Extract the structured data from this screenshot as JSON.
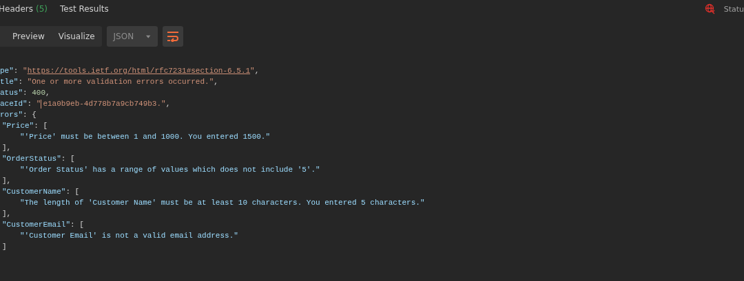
{
  "tabs": [
    {
      "label": "Headers",
      "count": "(5)",
      "selected": false
    },
    {
      "label": "Test Results",
      "selected": false
    }
  ],
  "status": {
    "label": "Statu"
  },
  "view_modes": [
    {
      "label": "Preview",
      "selected": false
    },
    {
      "label": "Visualize",
      "selected": false
    }
  ],
  "format_dropdown": {
    "value": "JSON"
  },
  "wrap_button": {
    "on": true
  },
  "code": [
    {
      "tokens": [
        {
          "kind": "key",
          "text": "pe\""
        },
        {
          "kind": "punct",
          "text": ": "
        },
        {
          "kind": "string",
          "text": "\""
        },
        {
          "kind": "link",
          "text": "https://tools.ietf.org/html/rfc7231#section-6.5.1"
        },
        {
          "kind": "string",
          "text": "\""
        },
        {
          "kind": "punct",
          "text": ","
        }
      ]
    },
    {
      "tokens": [
        {
          "kind": "key",
          "text": "tle\""
        },
        {
          "kind": "punct",
          "text": ": "
        },
        {
          "kind": "string",
          "text": "\"One or more validation errors occurred.\""
        },
        {
          "kind": "punct",
          "text": ","
        }
      ]
    },
    {
      "tokens": [
        {
          "kind": "key",
          "text": "atus\""
        },
        {
          "kind": "punct",
          "text": ": "
        },
        {
          "kind": "number",
          "text": "400"
        },
        {
          "kind": "punct",
          "text": ","
        }
      ]
    },
    {
      "tokens": [
        {
          "kind": "key",
          "text": "aceId\""
        },
        {
          "kind": "punct",
          "text": ": "
        },
        {
          "kind": "string",
          "text": "\""
        },
        {
          "kind": "cursor"
        },
        {
          "kind": "string",
          "text": "e1a0b9eb-4d778b7a9cb749b3.\""
        },
        {
          "kind": "punct",
          "text": ","
        }
      ]
    },
    {
      "tokens": [
        {
          "kind": "key",
          "text": "rors\""
        },
        {
          "kind": "punct",
          "text": ": {"
        }
      ],
      "children": [
        {
          "tokens": [
            {
              "kind": "key",
              "text": "\"Price\""
            },
            {
              "kind": "punct",
              "text": ": ["
            }
          ],
          "children": [
            {
              "tokens": [
                {
                  "kind": "value",
                  "text": "\"'Price' must be between 1 and 1000. You entered 1500.\""
                }
              ]
            }
          ]
        },
        {
          "tokens": [
            {
              "kind": "punct",
              "text": "],"
            }
          ]
        },
        {
          "tokens": [
            {
              "kind": "key",
              "text": "\"OrderStatus\""
            },
            {
              "kind": "punct",
              "text": ": ["
            }
          ],
          "children": [
            {
              "tokens": [
                {
                  "kind": "value",
                  "text": "\"'Order Status' has a range of values which does not include '5'.\""
                }
              ]
            }
          ]
        },
        {
          "tokens": [
            {
              "kind": "punct",
              "text": "],"
            }
          ]
        },
        {
          "tokens": [
            {
              "kind": "key",
              "text": "\"CustomerName\""
            },
            {
              "kind": "punct",
              "text": ": ["
            }
          ],
          "children": [
            {
              "tokens": [
                {
                  "kind": "value",
                  "text": "\"The length of 'Customer Name' must be at least 10 characters. You entered 5 characters.\""
                }
              ]
            }
          ]
        },
        {
          "tokens": [
            {
              "kind": "punct",
              "text": "],"
            }
          ]
        },
        {
          "tokens": [
            {
              "kind": "key",
              "text": "\"CustomerEmail\""
            },
            {
              "kind": "punct",
              "text": ": ["
            }
          ],
          "children": [
            {
              "tokens": [
                {
                  "kind": "value",
                  "text": "\"'Customer Email' is not a valid email address.\""
                }
              ]
            }
          ]
        },
        {
          "tokens": [
            {
              "kind": "punct",
              "text": "]"
            }
          ]
        }
      ]
    }
  ]
}
